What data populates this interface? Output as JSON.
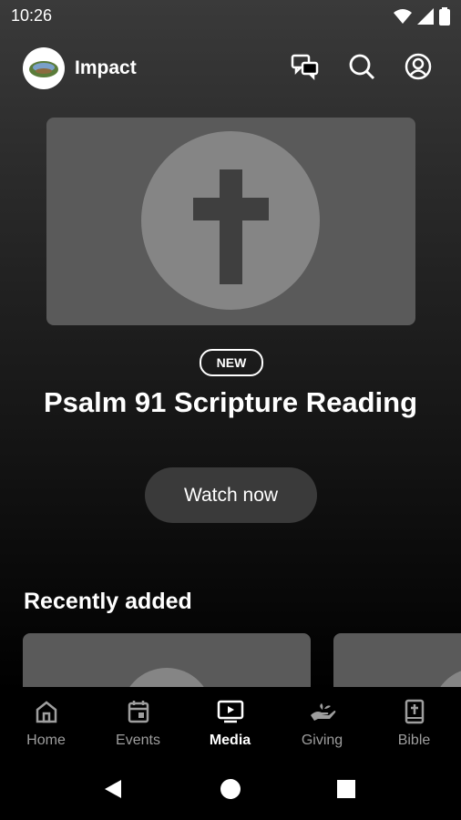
{
  "status_bar": {
    "time": "10:26",
    "icons": [
      "wifi-icon",
      "signal-icon",
      "battery-icon"
    ]
  },
  "header": {
    "title": "Impact",
    "actions": [
      "chat-icon",
      "search-icon",
      "account-icon"
    ]
  },
  "hero": {
    "badge": "NEW",
    "title": "Psalm 91 Scripture Reading",
    "button_label": "Watch now",
    "placeholder_icon": "cross-icon"
  },
  "recent": {
    "section_title": "Recently added"
  },
  "bottom_nav": {
    "items": [
      {
        "label": "Home",
        "icon": "home-icon",
        "active": false
      },
      {
        "label": "Events",
        "icon": "calendar-icon",
        "active": false
      },
      {
        "label": "Media",
        "icon": "tv-icon",
        "active": true
      },
      {
        "label": "Giving",
        "icon": "giving-hand-icon",
        "active": false
      },
      {
        "label": "Bible",
        "icon": "bible-icon",
        "active": false
      }
    ]
  },
  "colors": {
    "background_top": "#3a3a3a",
    "card": "#5a5a5a",
    "circle": "#858585",
    "button": "#3a3a3a",
    "inactive_nav": "#9e9e9e"
  }
}
